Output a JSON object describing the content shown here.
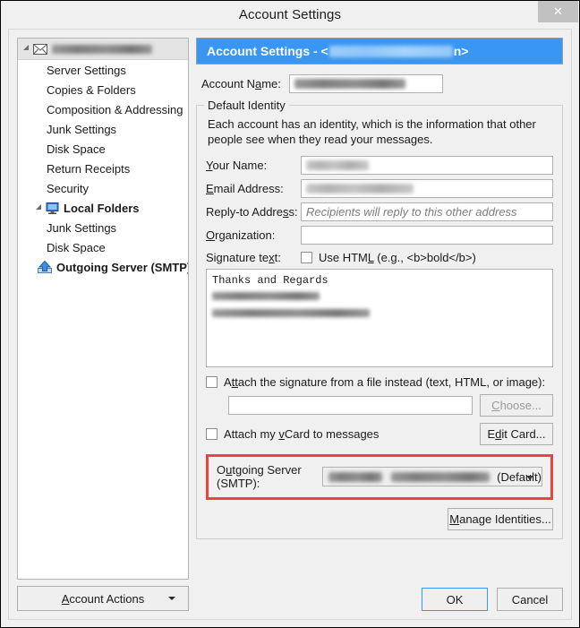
{
  "window": {
    "title": "Account Settings",
    "close_label": "✕"
  },
  "sidebar": {
    "account_label": "",
    "items": [
      {
        "label": "Server Settings",
        "level": "child"
      },
      {
        "label": "Copies & Folders",
        "level": "child"
      },
      {
        "label": "Composition & Addressing",
        "level": "child"
      },
      {
        "label": "Junk Settings",
        "level": "child"
      },
      {
        "label": "Disk Space",
        "level": "child"
      },
      {
        "label": "Return Receipts",
        "level": "child"
      },
      {
        "label": "Security",
        "level": "child"
      },
      {
        "label": "Local Folders",
        "level": "bold"
      },
      {
        "label": "Junk Settings",
        "level": "child"
      },
      {
        "label": "Disk Space",
        "level": "child"
      },
      {
        "label": "Outgoing Server (SMTP)",
        "level": "bold"
      }
    ],
    "account_actions_button": "Account Actions"
  },
  "banner": {
    "prefix": "Account Settings - <",
    "suffix": "n>"
  },
  "account_name": {
    "label_pre": "Account N",
    "label_key": "a",
    "label_post": "me:",
    "value": ""
  },
  "default_identity": {
    "legend": "Default Identity",
    "description": "Each account has an identity, which is the information that other people see when they read your messages.",
    "fields": [
      {
        "label_pre": "",
        "label_key": "Y",
        "label_post": "our Name:",
        "value": "",
        "placeholder": ""
      },
      {
        "label_pre": "",
        "label_key": "E",
        "label_post": "mail Address:",
        "value": "",
        "placeholder": ""
      },
      {
        "label_pre": "Reply-to Addre",
        "label_key": "s",
        "label_post": "s:",
        "value": "",
        "placeholder": "Recipients will reply to this other address"
      },
      {
        "label_pre": "",
        "label_key": "O",
        "label_post": "rganization:",
        "value": "",
        "placeholder": ""
      }
    ],
    "signature": {
      "label_pre": "Signature te",
      "label_key": "x",
      "label_post": "t:",
      "use_html_pre": "Use HTM",
      "use_html_key": "L",
      "use_html_post": " (e.g., <b>bold</b>)",
      "use_html_checked": false,
      "text_first_line": "Thanks and Regards"
    },
    "attach_file": {
      "label_pre": "A",
      "label_key": "tt",
      "label_post": "ach the signature from a file instead (text, HTML, or image):",
      "checked": false,
      "path_value": "",
      "choose_button_pre": "",
      "choose_button_key": "C",
      "choose_button_post": "hoose...",
      "choose_disabled": true
    },
    "attach_vcard": {
      "label_pre": "Attach my ",
      "label_key": "v",
      "label_post": "Card to messages",
      "checked": false,
      "edit_button_pre": "E",
      "edit_button_key": "d",
      "edit_button_post": "it Card..."
    },
    "smtp": {
      "label_pre": "O",
      "label_key": "u",
      "label_post": "tgoing Server (SMTP):",
      "value_suffix": "(Default)",
      "highlight_color": "#e8453c"
    },
    "manage_identities_pre": "M",
    "manage_identities_key": "a",
    "manage_identities_post": "nage Identities..."
  },
  "footer": {
    "ok_label": "OK",
    "cancel_label": "Cancel"
  }
}
